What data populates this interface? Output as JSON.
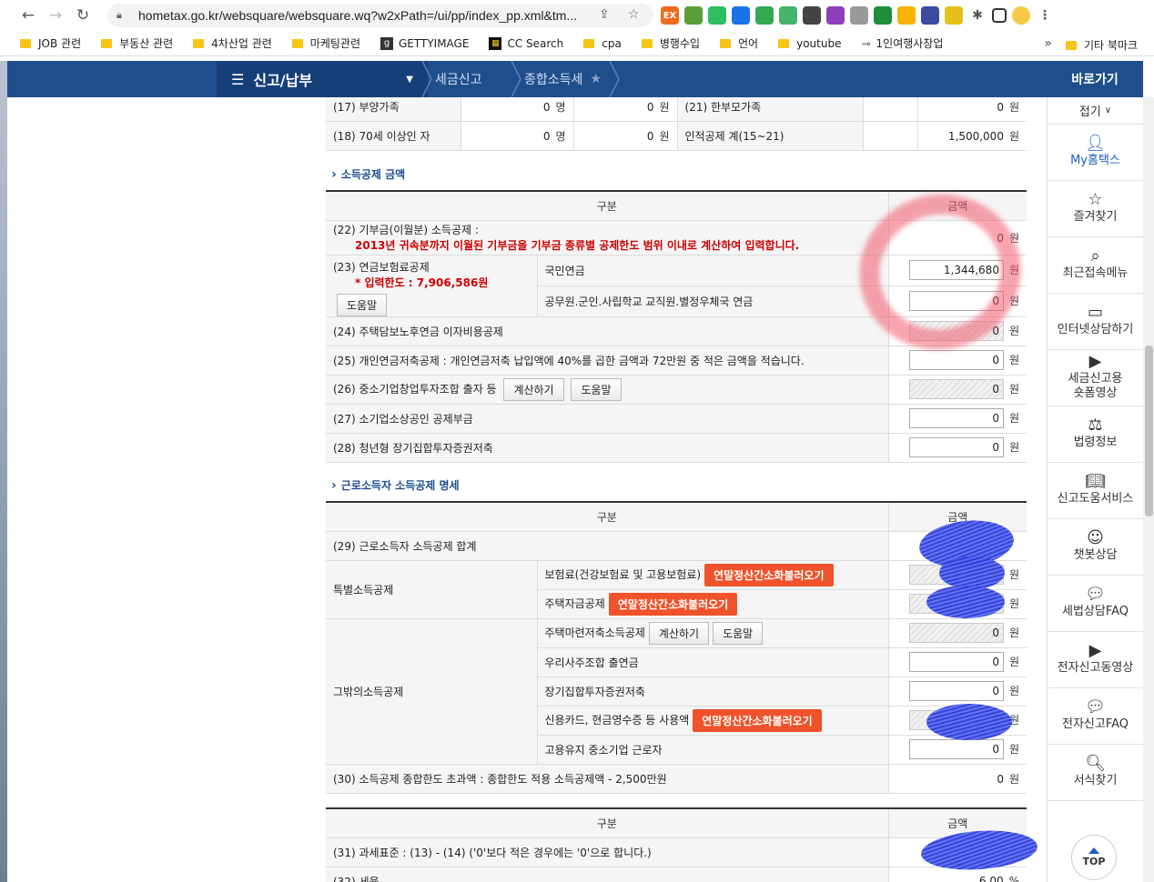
{
  "browser": {
    "url": "hometax.go.kr/websquare/websquare.wq?w2xPath=/ui/pp/index_pp.xml&tm...",
    "bookmarks": [
      "JOB 관련",
      "부동산 관련",
      "4차산업 관련",
      "마케팅관련",
      "GETTYIMAGE",
      "CC Search",
      "cpa",
      "병행수입",
      "언어",
      "youtube",
      "1인여행사창업"
    ],
    "bookmark_more": "»",
    "bookmark_other": "기타 북마크",
    "ext_label_1": "EX"
  },
  "nav": {
    "main_menu": "신고/납부",
    "crumb_1": "세금신고",
    "crumb_2": "종합소득세",
    "quick_title": "바로가기"
  },
  "sidebar": {
    "fold": "접기",
    "items": [
      {
        "label": "My홈택스",
        "icon": "person-icon"
      },
      {
        "label": "즐겨찾기",
        "icon": "star-icon"
      },
      {
        "label": "최근접속메뉴",
        "icon": "recent-search-icon"
      },
      {
        "label": "인터넷상담하기",
        "icon": "monitor-icon"
      },
      {
        "label": "세금신고용\n숏폼영상",
        "icon": "play-icon"
      },
      {
        "label": "법령정보",
        "icon": "gavel-icon"
      },
      {
        "label": "신고도움서비스",
        "icon": "book-icon"
      },
      {
        "label": "챗봇상담",
        "icon": "chatbot-icon"
      },
      {
        "label": "세법상담FAQ",
        "icon": "chat-icon"
      },
      {
        "label": "전자신고동영상",
        "icon": "play-icon"
      },
      {
        "label": "전자신고FAQ",
        "icon": "chat-icon"
      },
      {
        "label": "서식찾기",
        "icon": "search-icon"
      }
    ],
    "top": "TOP"
  },
  "personal": {
    "r17_label": "(17) 부양가족",
    "r17_count": "0",
    "r17_amount": "0",
    "r18_label": "(18) 70세 이상인 자",
    "r18_count": "0",
    "r18_amount": "0",
    "r21_label": "(21) 한부모가족",
    "r21_amount": "0",
    "total_label": "인적공제 계(15~21)",
    "total_amount": "1,500,000",
    "unit_person": "명",
    "unit_won": "원"
  },
  "income_deduction": {
    "title": "소득공제 금액",
    "col_category": "구분",
    "col_amount": "금액",
    "r22_label": "(22) 기부금(이월분) 소득공제 :",
    "r22_note": "2013년 귀속분까지 이월된 기부금을 기부금 종류별 공제한도 범위 이내로 계산하여 입력합니다.",
    "r22_amount": "0",
    "r23_label": "(23) 연금보험료공제",
    "r23_limit": "* 입력한도 : 7,906,586원",
    "help": "도움말",
    "calc": "계산하기",
    "r23_national": "국민연금",
    "r23_national_amount": "1,344,680",
    "r23_public": "공무원.군인.사립학교 교직원.별정우체국 연금",
    "r23_public_amount": "0",
    "r24_label": "(24) 주택담보노후연금 이자비용공제",
    "r24_amount": "0",
    "r25_label": "(25) 개인연금저축공제 : 개인연금저축 납입액에 40%를 곱한 금액과 72만원 중 적은 금액을 적습니다.",
    "r25_amount": "0",
    "r26_label": "(26) 중소기업창업투자조합 출자 등",
    "r26_amount": "0",
    "r27_label": "(27) 소기업소상공인 공제부금",
    "r27_amount": "0",
    "r28_label": "(28) 청년형 장기집합투자증권저축",
    "r28_amount": "0"
  },
  "earned_income": {
    "title": "근로소득자 소득공제 명세",
    "col_category": "구분",
    "col_amount": "금액",
    "r29_label": "(29) 근로소득자 소득공제 합계",
    "special": "특별소득공제",
    "insurance": "보험료(건강보험료 및 고용보험료)",
    "housing_fund": "주택자금공제",
    "import_btn": "연말정산간소화불러오기",
    "other": "그밖의소득공제",
    "housing_saving": "주택마련저축소득공제",
    "housing_saving_amount": "0",
    "esop": "우리사주조합 출연금",
    "esop_amount": "0",
    "long_term": "장기집합투자증권저축",
    "long_term_amount": "0",
    "card": "신용카드, 현금영수증 등 사용액",
    "employment": "고용유지 중소기업 근로자",
    "employment_amount": "0",
    "r30_label": "(30) 소득공제 종합한도 초과액 : 종합한도 적용 소득공제액 - 2,500만원",
    "r30_amount": "0"
  },
  "tax_base": {
    "col_category": "구분",
    "col_amount": "금액",
    "r31_label": "(31) 과세표준 : (13) - (14) ('0'보다 적은 경우에는 '0'으로 합니다.)",
    "r32_label": "(32) 세율",
    "r32_value": "6.00",
    "r32_unit": "%"
  }
}
